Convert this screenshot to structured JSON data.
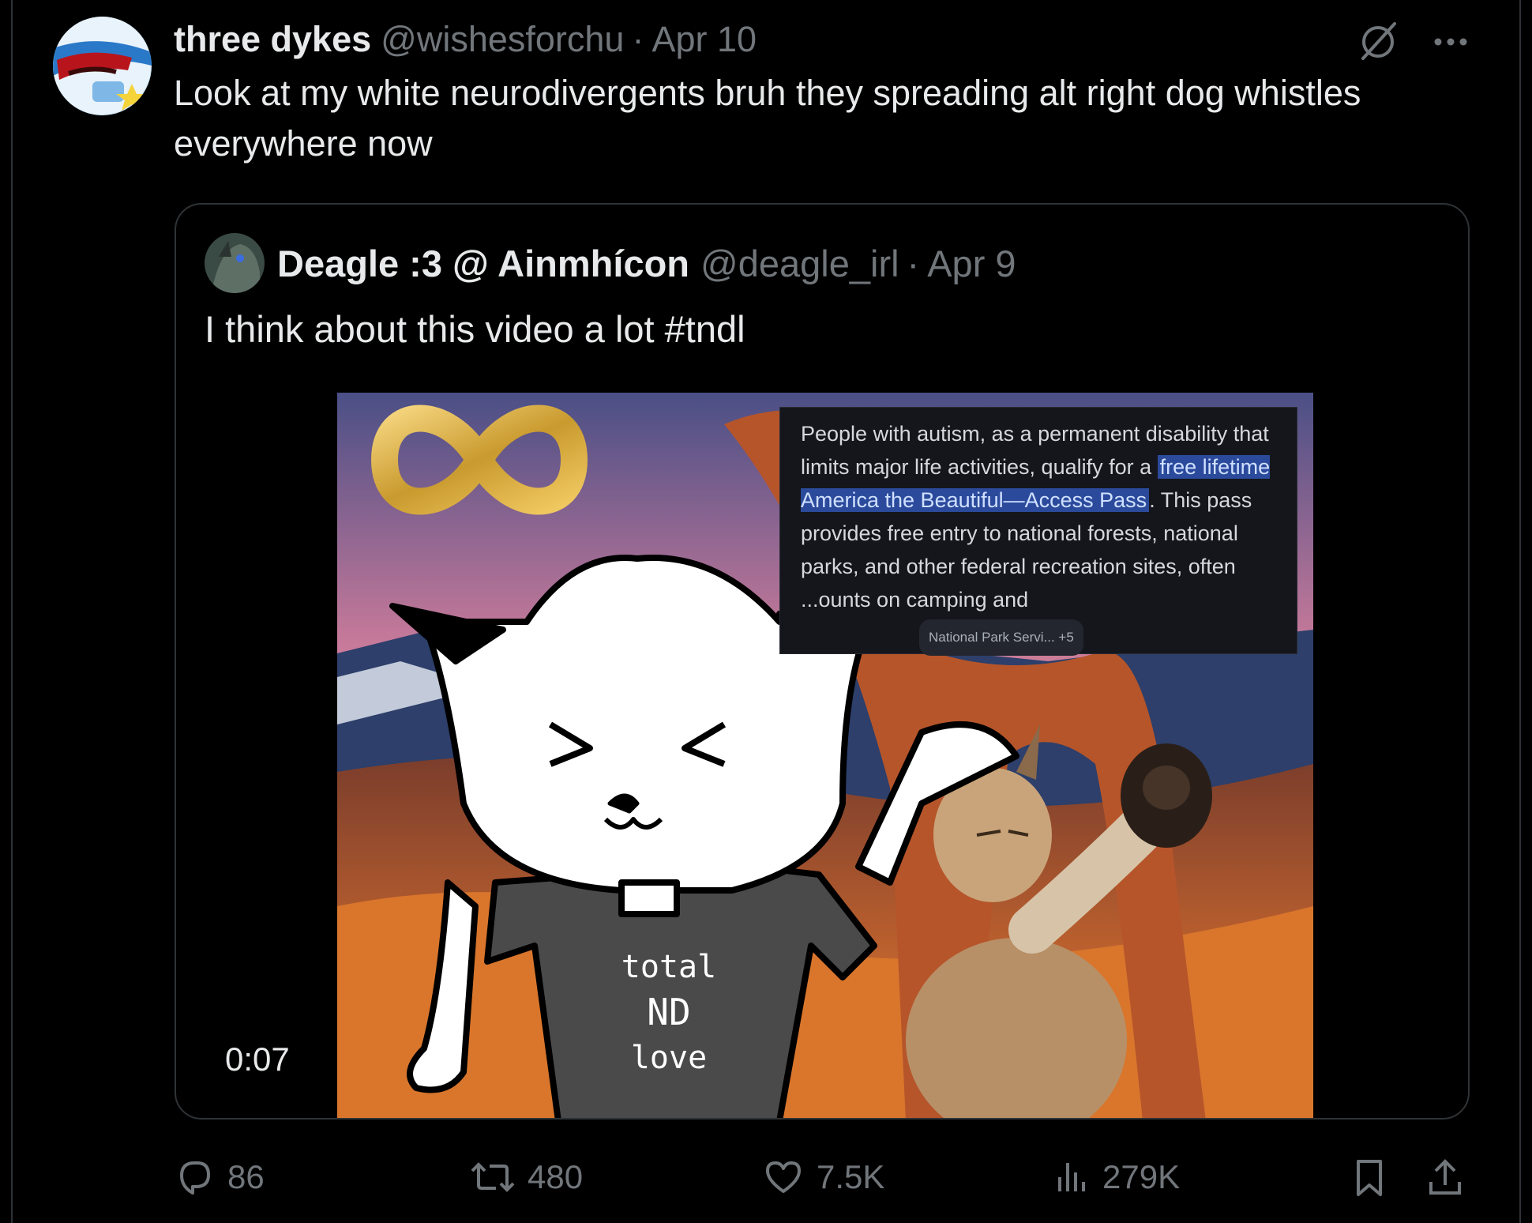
{
  "tweet": {
    "display_name": "three dykes",
    "handle": "@wishesforchu",
    "date_sep": "·",
    "date": "Apr 10",
    "text": "Look at my white neurodivergents bruh they spreading alt right dog whistles everywhere now"
  },
  "quoted_tweet": {
    "display_name": "Deagle :3 @ Ainmhícon",
    "handle": "@deagle_irl",
    "date_sep": "·",
    "date": "Apr 9",
    "text": "I think about this video a lot #tndl",
    "video": {
      "duration": "0:07",
      "caption_text_1": "People with autism, as a permanent disability that limits major life activities, qualify for a ",
      "caption_highlight": "free lifetime America the Beautiful—Access Pass",
      "caption_text_2": ". This pass provides free entry to national forests, national parks, and other federal recreation sites, often ",
      "caption_text_3": "...ounts on camping and",
      "caption_source": "National Park Servi...  +5",
      "shirt_line_1": "total",
      "shirt_line_2": "ND",
      "shirt_line_3": "love"
    }
  },
  "actions": {
    "replies": "86",
    "reposts": "480",
    "likes": "7.5K",
    "views": "279K"
  },
  "icons": {
    "grok": "grok-slash-icon",
    "more": "more-icon",
    "reply": "reply-icon",
    "repost": "repost-icon",
    "like": "heart-icon",
    "views": "views-icon",
    "bookmark": "bookmark-icon",
    "share": "share-icon"
  },
  "colors": {
    "background": "#000000",
    "text": "#e7e9ea",
    "muted": "#71767b",
    "border": "#2f3336"
  }
}
